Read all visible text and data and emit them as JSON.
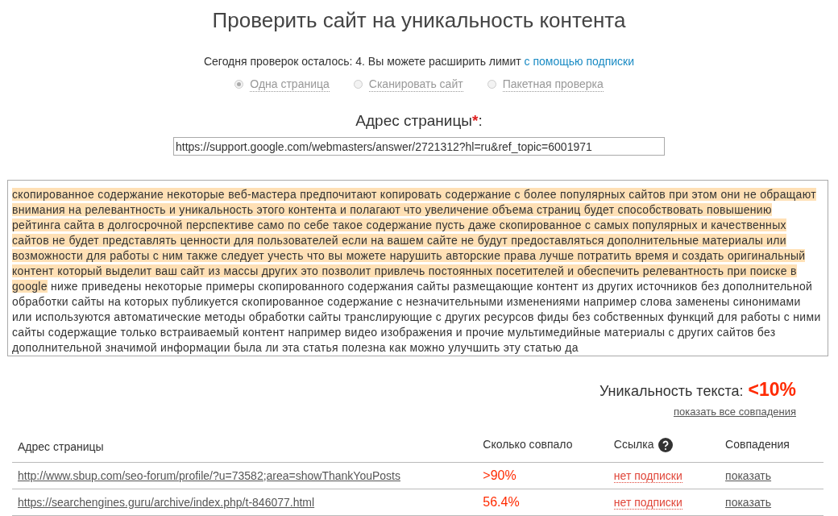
{
  "title": "Проверить сайт на уникальность контента",
  "quota": {
    "text": "Сегодня проверок осталось: 4. Вы можете расширить лимит",
    "link": "с помощью подписки"
  },
  "modes": [
    {
      "label": "Одна страница",
      "selected": true
    },
    {
      "label": "Сканировать сайт",
      "selected": false
    },
    {
      "label": "Пакетная проверка",
      "selected": false
    }
  ],
  "address": {
    "label": "Адрес страницы",
    "required_mark": "*",
    "suffix": ":",
    "value": "https://support.google.com/webmasters/answer/2721312?hl=ru&ref_topic=6001971"
  },
  "text_segments": [
    {
      "text": "скопированное содержание некоторые веб-мастера предпочитают копировать содержание с более популярных сайтов при этом они не обращают внимания на релевантность и уникальность этого контента и полагают что увеличение объема страниц будет способствовать повышению рейтинга сайта в долгосрочной перспективе само по себе такое содержание пусть даже скопированное с самых популярных и качественных сайтов не будет представлять ценности для пользователей если на вашем сайте не будут предоставляться дополнительные материалы или возможности для работы с ним также следует учесть что вы можете нарушить авторские права лучше потратить время и создать оригинальный контент который выделит ваш сайт из массы других это позволит привлечь постоянных посетителей и обеспечить релевантность при поиске в google",
      "highlighted": true
    },
    {
      "text": " ниже приведены некоторые примеры скопированного содержания сайты размещающие контент из других источников без дополнительной обработки сайты на которых публикуется скопированное содержание с незначительными изменениями например слова заменены синонимами или используются автоматические методы обработки сайты транслирующие с других ресурсов фиды без собственных функций для работы с ними сайты содержащие только встраиваемый контент например видео изображения и прочие мультимедийные материалы с других сайтов без дополнительной значимой информации была ли эта статья полезна как можно улучшить эту статью да",
      "highlighted": false
    }
  ],
  "result": {
    "label": "Уникальность текста:",
    "value": "<10%",
    "show_all_link": "показать все совпадения"
  },
  "table": {
    "columns": [
      {
        "label": "Адрес страницы",
        "help": false
      },
      {
        "label": "Сколько совпало",
        "help": false
      },
      {
        "label": "Ссылка",
        "help": true
      },
      {
        "label": "Совпадения",
        "help": false
      }
    ],
    "rows": [
      {
        "url": "http://www.sbup.com/seo-forum/profile/?u=73582;area=showThankYouPosts",
        "match": ">90%",
        "link": "нет подписки",
        "matches": "показать"
      },
      {
        "url": "https://searchengines.guru/archive/index.php/t-846077.html",
        "match": "56.4%",
        "link": "нет подписки",
        "matches": "показать"
      }
    ]
  }
}
